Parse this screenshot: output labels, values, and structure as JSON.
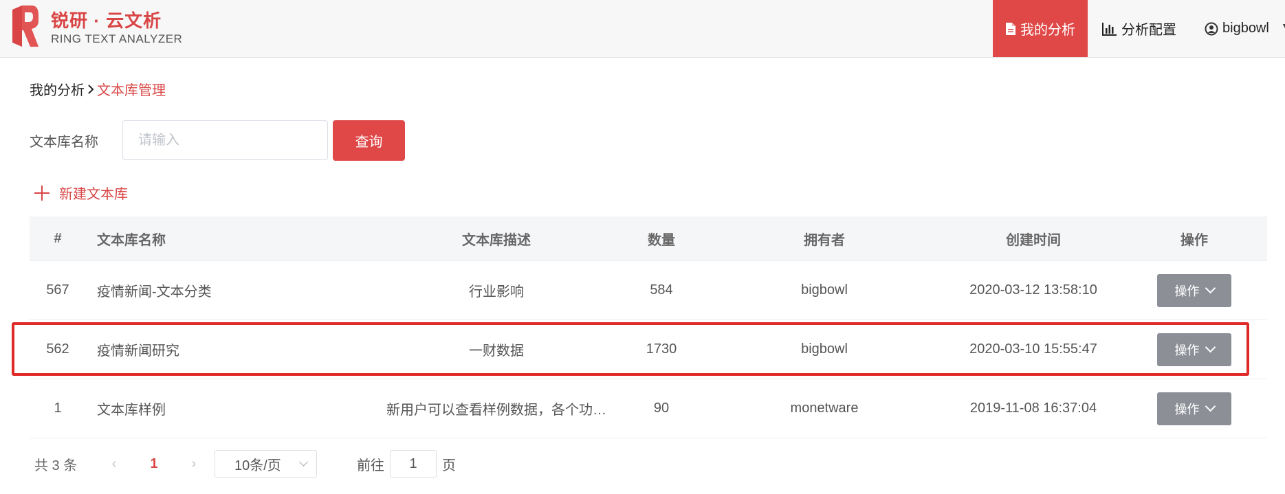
{
  "header": {
    "logo_cn": "锐研 · 云文析",
    "logo_en": "RING TEXT ANALYZER",
    "nav": {
      "my_analysis": "我的分析",
      "analysis_config": "分析配置",
      "user": "bigbowl"
    },
    "colors": {
      "brand": "#d94545",
      "nav_active_bg": "#e04848"
    }
  },
  "breadcrumb": {
    "home": "我的分析",
    "current": "文本库管理"
  },
  "search": {
    "label": "文本库名称",
    "placeholder": "请输入",
    "button": "查询"
  },
  "new_library": "新建文本库",
  "table": {
    "headers": [
      "#",
      "文本库名称",
      "文本库描述",
      "数量",
      "拥有者",
      "创建时间",
      "操作"
    ],
    "rows": [
      {
        "id": "567",
        "name": "疫情新闻-文本分类",
        "desc": "行业影响",
        "count": "584",
        "owner": "bigbowl",
        "created": "2020-03-12 13:58:10",
        "action": "操作"
      },
      {
        "id": "562",
        "name": "疫情新闻研究",
        "desc": "一财数据",
        "count": "1730",
        "owner": "bigbowl",
        "created": "2020-03-10 15:55:47",
        "action": "操作"
      },
      {
        "id": "1",
        "name": "文本库样例",
        "desc": "新用户可以查看样例数据，各个功…",
        "count": "90",
        "owner": "monetware",
        "created": "2019-11-08 16:37:04",
        "action": "操作"
      }
    ],
    "highlighted_row_index": 1
  },
  "pagination": {
    "total": "共 3 条",
    "prev": "‹",
    "current_page": "1",
    "next": "›",
    "page_size": "10条/页",
    "goto_label": "前往",
    "goto_value": "1",
    "goto_unit": "页"
  }
}
